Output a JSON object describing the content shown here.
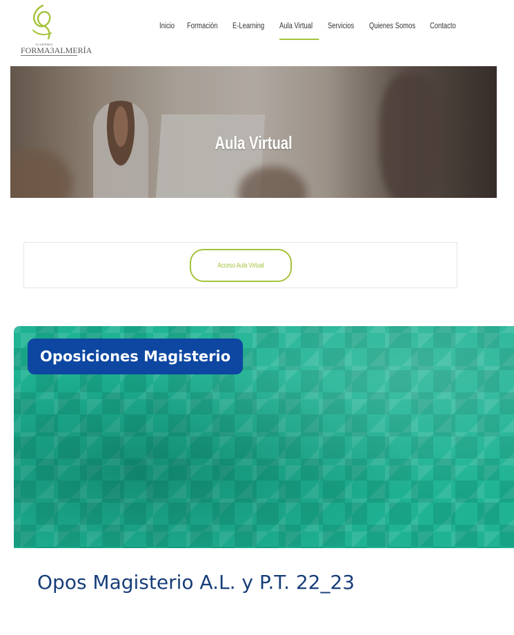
{
  "logo": {
    "small_text": "ACADEMIA",
    "name": "FORMA3ALMERÍA",
    "accent_color": "#a4c33a"
  },
  "nav": {
    "items": [
      {
        "label": "Inicio",
        "active": false
      },
      {
        "label": "Formación",
        "active": false
      },
      {
        "label": "E-Learning",
        "active": false
      },
      {
        "label": "Aula Virtual",
        "active": true
      },
      {
        "label": "Servicios",
        "active": false
      },
      {
        "label": "Quienes Somos",
        "active": false
      },
      {
        "label": "Contacto",
        "active": false
      }
    ]
  },
  "hero": {
    "title": "Aula Virtual"
  },
  "access": {
    "button_label": "Acceso Aula Virtual"
  },
  "course": {
    "category": "Oposiciones Magisterio",
    "title": "Opos Magisterio A.L. y P.T. 22_23",
    "badge_color": "#0d47a1",
    "banner_color": "#1fb394"
  }
}
